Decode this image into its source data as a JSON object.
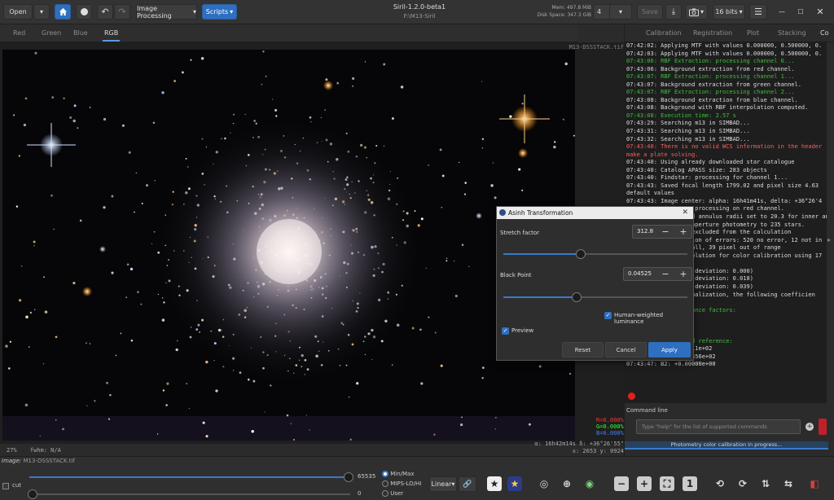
{
  "header": {
    "open_label": "Open",
    "image_processing_label": "Image Processing",
    "scripts_label": "Scripts",
    "app_title": "Siril-1.2.0-beta1",
    "working_dir": "F:\\M13-Siril",
    "mem_label": "Mem: 497.8 MiB",
    "disk_label": "Disk Space: 347.3 GiB",
    "threads_value": "4",
    "save_label": "Save",
    "bit_depth": "16 bits",
    "icons": [
      "dropdown-arrow-icon",
      "home-icon",
      "record-icon",
      "undo-icon",
      "redo-icon",
      "download-icon",
      "camera-icon",
      "hamburger-menu-icon",
      "minimize-icon",
      "maximize-icon",
      "close-icon"
    ]
  },
  "channel_tabs": [
    "Red",
    "Green",
    "Blue",
    "RGB"
  ],
  "image": {
    "filename": "M13-DSSSTACK.tif",
    "zoom": "27%",
    "stats_r": "R=0.000%",
    "stats_g": "G=0.000%",
    "stats_b": "B=0.000%",
    "coord_radec": "α: 16h42m14s δ: +36°26'55\"",
    "coord_xy": "x: 2653 y: 0924",
    "fwhm_label": "fwhm: N/A"
  },
  "right_tabs": [
    "Calibration",
    "Registration",
    "Plot",
    "Stacking",
    "Co"
  ],
  "console_lines": [
    {
      "text": "07:42:02: Applying MTF with values 0.000000, 0.500000, 0.",
      "cls": ""
    },
    {
      "text": "07:42:03: Applying MTF with values 0.000000, 0.500000, 0.",
      "cls": ""
    },
    {
      "text": "07:43:06: RBF Extraction: processing channel 0...",
      "cls": "green"
    },
    {
      "text": "07:43:06: Background extraction from red channel.",
      "cls": ""
    },
    {
      "text": "07:43:07: RBF Extraction: processing channel 1...",
      "cls": "green"
    },
    {
      "text": "07:43:07: Background extraction from green channel.",
      "cls": ""
    },
    {
      "text": "07:43:07: RBF Extraction: processing channel 2...",
      "cls": "green"
    },
    {
      "text": "07:43:08: Background extraction from blue channel.",
      "cls": ""
    },
    {
      "text": "07:43:08: Background with RBF interpolation computed.",
      "cls": ""
    },
    {
      "text": "07:43:08: Execution time: 2.57 s",
      "cls": "green"
    },
    {
      "text": "07:43:29: Searching m13 in SIMBAD...",
      "cls": ""
    },
    {
      "text": "07:43:31: Searching m13 in SIMBAD...",
      "cls": ""
    },
    {
      "text": "07:43:32: Searching m13 in SIMBAD...",
      "cls": ""
    },
    {
      "text": "07:43:40: There is no valid WCS information in the header",
      "cls": "red"
    },
    {
      "text": "make a plate solving.",
      "cls": "red"
    },
    {
      "text": "07:43:40: Using already downloaded star catalogue",
      "cls": ""
    },
    {
      "text": "07:43:40: Catalog APASS size: 283 objects",
      "cls": ""
    },
    {
      "text": "07:43:40: Findstar: processing for channel 1...",
      "cls": ""
    },
    {
      "text": "07:43:43: Saved focal length 1799.02 and pixel size 4.63",
      "cls": ""
    },
    {
      "text": "default values",
      "cls": ""
    },
    {
      "text": "07:43:43: Image center: alpha: 16h41m41s, delta: +36°26'4",
      "cls": ""
    },
    {
      "text": "07:43:43: Findstar: processing on red channel.",
      "cls": ""
    },
    {
      "text": "07:43:47: Background annulus radii set to 20.3 for inner and 38.3",
      "cls": ""
    },
    {
      "text": "07:43:47: Applying aperture photometry to 235 stars.",
      "cls": ""
    },
    {
      "text": "07:43:47: 88 stars excluded from the calculation",
      "cls": ""
    },
    {
      "text": "07:43:47: Distribution of errors: 520 no error, 12 not in",
      "cls": ""
    },
    {
      "text": "07:43:47: 71 too small, 39 pixel out of range",
      "cls": ""
    },
    {
      "text": "07:43:47: Found a solution for color calibration using 17",
      "cls": ""
    },
    {
      "text": "07:43:47: ",
      "cls": ""
    },
    {
      "text": "07:43:47: R: 1.000     (deviation: 0.000)",
      "cls": ""
    },
    {
      "text": "07:43:47: G: 1.088     (deviation: 0.018)",
      "cls": ""
    },
    {
      "text": "07:43:47: B: 1.137     (deviation: 0.039)",
      "cls": ""
    },
    {
      "text": "07:43:47: After normalization, the following coefficien",
      "cls": ""
    },
    {
      "text": "",
      "cls": ""
    },
    {
      "text": "07:43:47: White balance factors:",
      "cls": "green"
    },
    {
      "text": "",
      "cls": ""
    },
    {
      "text": "",
      "cls": ""
    },
    {
      "text": "",
      "cls": ""
    },
    {
      "text": "07:43:47: Background reference:",
      "cls": "green"
    },
    {
      "text": "07:43:47: R: +3.11311e+02",
      "cls": ""
    },
    {
      "text": "07:43:47: B1: +3.12456e+02",
      "cls": ""
    },
    {
      "text": "07:43:47: B2: +0.00000e+00",
      "cls": ""
    }
  ],
  "command": {
    "label": "Command line",
    "placeholder": "Type \"help\" for the list of supported commands",
    "progress_text": "Photometry color calibration in progress..."
  },
  "dialog": {
    "title": "Asinh Transformation",
    "stretch_label": "Stretch factor",
    "stretch_value": "312.8",
    "stretch_level": 0.42,
    "black_label": "Black Point",
    "black_value": "0.04525",
    "black_level": 0.4,
    "luminance_label": "Human-weighted luminance",
    "preview_label": "Preview",
    "reset_label": "Reset",
    "cancel_label": "Cancel",
    "apply_label": "Apply"
  },
  "bottom": {
    "image_label": "Image:",
    "image_name": "M13-DSSSTACK.tif",
    "cut_label": "cut",
    "high_value": "65535",
    "low_value": "0",
    "modes": [
      "Min/Max",
      "MIPS-LO/HI",
      "User"
    ],
    "linear_label": "Linear",
    "zoom_one": "1",
    "icons": [
      "lock-icon",
      "star-catalog-icon",
      "star-icon",
      "astrometry-icon",
      "globe-icon",
      "target-icon",
      "zoom-out-icon",
      "zoom-in-icon",
      "zoom-fit-icon",
      "zoom-100-icon",
      "rotate-left-icon",
      "rotate-right-icon",
      "mirror-icon",
      "rgb-compositing-icon"
    ]
  },
  "colors": {
    "accent": "#2e6fbf",
    "green_log": "#3fbf3f",
    "red_log": "#ff5d5d",
    "stop": "#e02020"
  }
}
